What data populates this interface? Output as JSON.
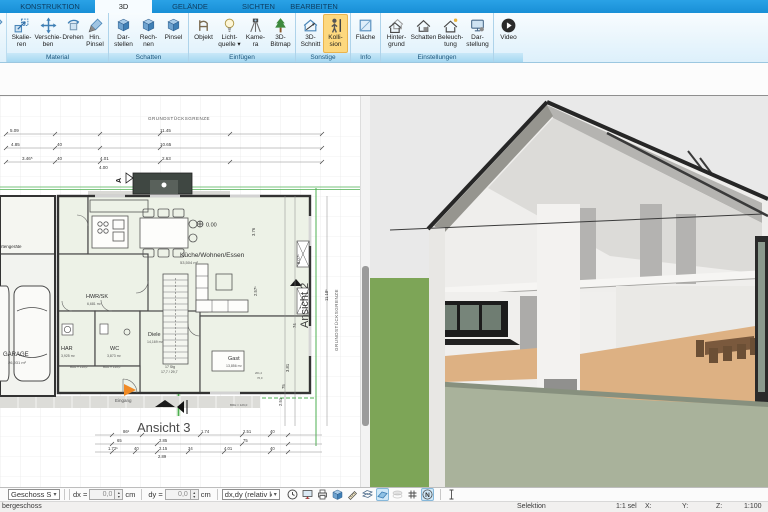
{
  "ribbon": {
    "tabs": [
      {
        "label": "KONSTRUKTION",
        "active": false
      },
      {
        "label": "3D",
        "active": true
      },
      {
        "label": "GELÄNDE",
        "active": false
      },
      {
        "label": "SICHTEN",
        "active": false
      },
      {
        "label": "BEARBEITEN",
        "active": false
      }
    ],
    "groups": [
      {
        "name": "Material",
        "buttons": [
          {
            "label": "Skalie-\nren",
            "icon": "scale-icon"
          },
          {
            "label": "Verschie-\nben",
            "icon": "move-icon"
          },
          {
            "label": "Drehen",
            "icon": "rotate-icon"
          },
          {
            "label": "Hin.\nPinsel",
            "icon": "brush-icon"
          }
        ]
      },
      {
        "name": "Schatten",
        "buttons": [
          {
            "label": "Dar-\nstellen",
            "icon": "cube-icon"
          },
          {
            "label": "Rech-\nnen",
            "icon": "cube-icon"
          },
          {
            "label": "Pinsel",
            "icon": "brush-icon"
          }
        ]
      },
      {
        "name": "Einfügen",
        "buttons": [
          {
            "label": "Objekt",
            "icon": "chair-icon"
          },
          {
            "label": "Licht-\nquelle ▾",
            "icon": "bulb-icon"
          },
          {
            "label": "Kame-\nra",
            "icon": "camera-tripod-icon"
          },
          {
            "label": "3D-\nBitmap",
            "icon": "tree-icon"
          }
        ]
      },
      {
        "name": "Sonstige",
        "buttons": [
          {
            "label": "3D-\nSchnitt",
            "icon": "section-icon"
          },
          {
            "label": "Kolli-\nsion",
            "icon": "person-icon",
            "active": true
          }
        ]
      },
      {
        "name": "Info",
        "buttons": [
          {
            "label": "Fläche",
            "icon": "area-icon"
          }
        ]
      },
      {
        "name": "Einstellungen",
        "buttons": [
          {
            "label": "Hinter-\ngrund",
            "icon": "houses-icon"
          },
          {
            "label": "Schatten",
            "icon": "house-shadow-icon"
          },
          {
            "label": "Beleuch-\ntung",
            "icon": "house-sun-icon"
          },
          {
            "label": "Dar-\nstellung",
            "icon": "monitor-icon"
          }
        ]
      },
      {
        "name": "",
        "buttons": [
          {
            "label": "Video",
            "icon": "play-icon"
          }
        ]
      }
    ],
    "colors": {
      "tab_bar": "#1e98e0",
      "active_tab_bg": "#f7fcff",
      "group_strip": "#aedcf3",
      "highlight": "#fdd87e"
    }
  },
  "plan": {
    "boundary_label": "GRUNDSTÜCKSGRENZE",
    "rooms": [
      {
        "name": "Küche/Wohnen/Essen",
        "area": "53,504 m²"
      },
      {
        "name": "HWR/SK",
        "area": "6,681 m²"
      },
      {
        "name": "HAR",
        "area": "3,925 m²"
      },
      {
        "name": "WC",
        "area": "3,873 m²"
      },
      {
        "name": "Diele",
        "area": "14,169 m²"
      },
      {
        "name": "Gast",
        "area": "13,856 m²"
      },
      {
        "name": "GARAGE",
        "area": "26,931 m²"
      },
      {
        "name": "rtengeräte",
        "area": ""
      }
    ],
    "level_marker": "0.00",
    "stairs": {
      "line1": "17 Stg",
      "line2": "17,7 / 29,7"
    },
    "entrance_label": "Eingang",
    "view_markers": {
      "ansicht2": "Ansicht 2",
      "ansicht3": "Ansicht 3",
      "a": "A"
    },
    "sill_notes": [
      "BRH = 139,0",
      "BRH = 139,0",
      "BRH = 126,0"
    ],
    "small_notes": [
      "201,2",
      "76,0"
    ],
    "dims_top": [
      "5.09",
      "11.45",
      "4.85",
      "40",
      "10.65",
      "3.46⁵",
      "40",
      "4.01",
      "2.63",
      "4.00"
    ],
    "dims_bottom": [
      "86⁵",
      "1.74",
      "2.51",
      "40",
      "65",
      "2.85",
      "75",
      "1.72⁵",
      "40",
      "2.15",
      "34",
      "4.01",
      "40",
      "2.89"
    ],
    "dims_right": [
      "3.76",
      "2.57⁵",
      "8.07⁵",
      "74",
      "11.18⁵",
      "3.81",
      "75",
      "2.51"
    ]
  },
  "view3d": {
    "colors": {
      "sky": "#e9e9e9",
      "grass": "#7da557",
      "ground_cut": "#a9b29b",
      "wall": "#efeeec",
      "roof_edge": "#262626",
      "wood_floor": "#ddb183",
      "window_frame": "#1c1c1c",
      "glass": "#6f7d72",
      "furniture_wood": "#7a593d"
    }
  },
  "toolbar": {
    "floor_select": "Geschoss S",
    "dx_label": "dx =",
    "dx_value": "0,0",
    "dx_unit": "cm",
    "dy_label": "dy =",
    "dy_value": "0,0",
    "dy_unit": "cm",
    "mode_select": "dx,dy (relativ ka"
  },
  "statusbar": {
    "floor": "bergeschoss",
    "selection": "Selektion",
    "scale_sel": "1:1 sel",
    "x_label": "X:",
    "y_label": "Y:",
    "z_label": "Z:",
    "scale": "1:100"
  }
}
